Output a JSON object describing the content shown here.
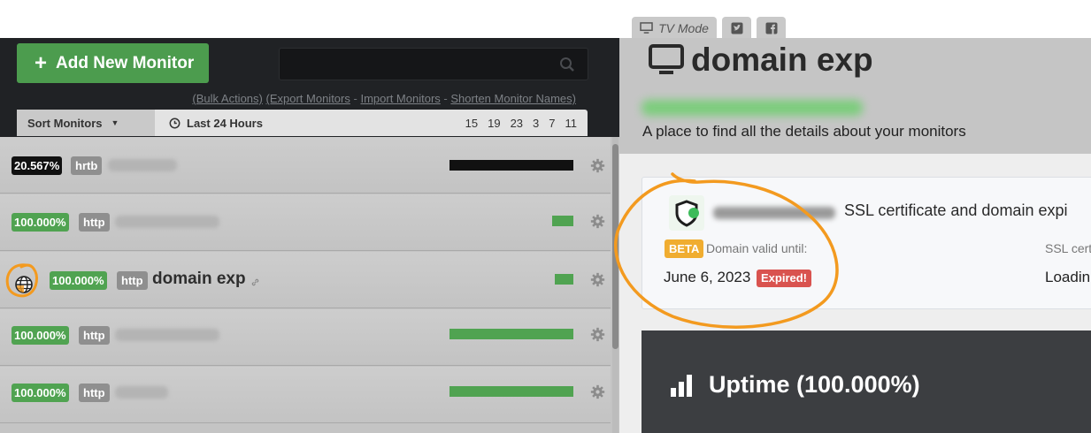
{
  "toolbar": {
    "add_label": "Add New Monitor",
    "links": {
      "bulk": "(Bulk Actions)",
      "export": "(Export Monitors",
      "import": "Import Monitors",
      "shorten": "Shorten Monitor Names)"
    },
    "sort_label": "Sort Monitors",
    "period_label": "Last 24 Hours",
    "hours": [
      "15",
      "19",
      "23",
      "3",
      "7",
      "11"
    ]
  },
  "monitors": [
    {
      "uptime": "20.567%",
      "type": "hrtb",
      "uptime_bar_fraction": 1.0,
      "status_color": "#111111"
    },
    {
      "uptime": "100.000%",
      "type": "http",
      "uptime_bar_fraction": 0.17,
      "status_color": "#50a351"
    },
    {
      "uptime": "100.000%",
      "type": "http",
      "name": "domain exp",
      "uptime_bar_fraction": 0.15,
      "status_color": "#50a351"
    },
    {
      "uptime": "100.000%",
      "type": "http",
      "uptime_bar_fraction": 1.0,
      "status_color": "#50a351"
    },
    {
      "uptime": "100.000%",
      "type": "http",
      "uptime_bar_fraction": 1.0,
      "status_color": "#50a351"
    }
  ],
  "tabs": {
    "tv_mode": "TV Mode"
  },
  "detail": {
    "title": "domain exp",
    "subtitle": "A place to find all the details about your monitors",
    "ssl_title": "SSL certificate and domain expi",
    "beta": "BETA",
    "valid_label": "Domain valid until:",
    "ssl_cert_label": "SSL cert",
    "valid_date": "June 6, 2023",
    "expired": "Expired!",
    "loading": "Loadin",
    "uptime": "Uptime (100.000%)"
  },
  "colors": {
    "accent_green": "#4c9c4e",
    "expired_red": "#d9534f",
    "beta_orange": "#f0ad30",
    "annotation": "#f39a1f"
  }
}
